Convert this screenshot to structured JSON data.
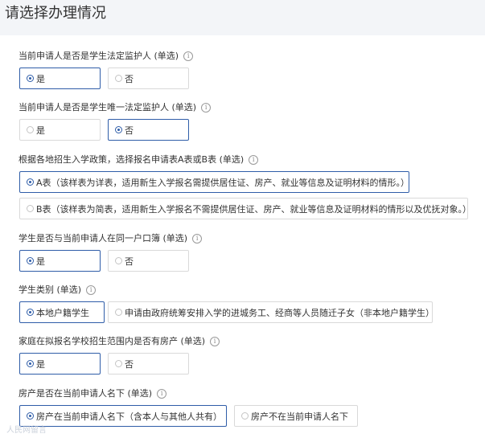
{
  "title": "请选择办理情况",
  "questions": [
    {
      "label": "当前申请人是否是学生法定监护人 (单选)",
      "options": [
        "是",
        "否"
      ],
      "selected": 0
    },
    {
      "label": "当前申请人是否是学生唯一法定监护人 (单选)",
      "options": [
        "是",
        "否"
      ],
      "selected": 1
    },
    {
      "label": "根据各地招生入学政策，选择报名申请表A表或B表 (单选)",
      "options": [
        "A表（该样表为详表，适用新生入学报名需提供居住证、房产、就业等信息及证明材料的情形。）",
        "B表（该样表为简表，适用新生入学报名不需提供居住证、房产、就业等信息及证明材料的情形以及优抚对象。）"
      ],
      "selected": 0
    },
    {
      "label": "学生是否与当前申请人在同一户口簿 (单选)",
      "options": [
        "是",
        "否"
      ],
      "selected": 0
    },
    {
      "label": "学生类别 (单选)",
      "options": [
        "本地户籍学生",
        "申请由政府统筹安排入学的进城务工、经商等人员随迁子女（非本地户籍学生）"
      ],
      "selected": 0
    },
    {
      "label": "家庭在拟报名学校招生范围内是否有房产 (单选)",
      "options": [
        "是",
        "否"
      ],
      "selected": 0
    },
    {
      "label": "房产是否在当前申请人名下 (单选)",
      "options": [
        "房产在当前申请人名下（含本人与其他人共有）",
        "房产不在当前申请人名下"
      ],
      "selected": 0
    }
  ],
  "info_glyph": "i",
  "watermark": "人民网留言",
  "colors": {
    "accent": "#2f5da8",
    "border": "#d9d9d9"
  }
}
